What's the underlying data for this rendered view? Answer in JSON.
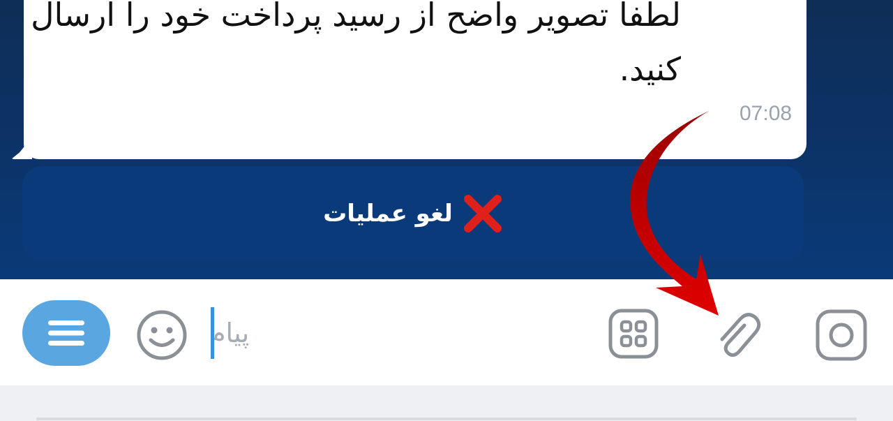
{
  "message": {
    "text": "لطفاً تصویر واضح از رسید پرداخت خود را ارسال کنید.",
    "time": "07:08"
  },
  "cancel_button": {
    "label": "لغو عملیات",
    "icon": "x-icon",
    "icon_color": "#e0201b"
  },
  "input_bar": {
    "placeholder": "پیام",
    "menu_icon": "hamburger-menu-icon",
    "emoji_icon": "smiley-icon",
    "apps_icon": "grid-apps-icon",
    "attach_icon": "paperclip-icon",
    "camera_icon": "camera-icon"
  },
  "colors": {
    "chat_background": "#0c3265",
    "bubble": "#ffffff",
    "cancel_button": "#0b3a7a",
    "menu_button": "#5aa6e0",
    "annotation_arrow": "#c00000"
  }
}
